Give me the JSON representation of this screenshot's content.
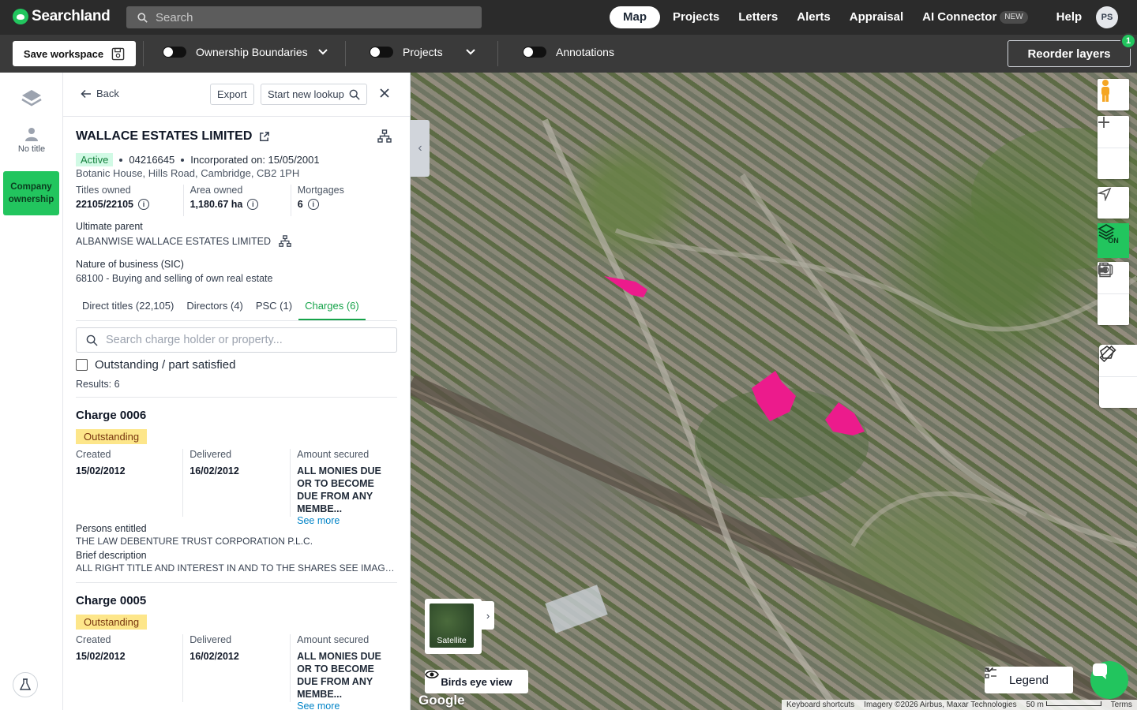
{
  "nav": {
    "logo": "Searchland",
    "search_placeholder": "Search",
    "items": [
      {
        "label": "Map",
        "active": true
      },
      {
        "label": "Projects"
      },
      {
        "label": "Letters"
      },
      {
        "label": "Alerts"
      },
      {
        "label": "Appraisal"
      },
      {
        "label": "AI Connector",
        "badge": "NEW"
      },
      {
        "label": "Help"
      }
    ],
    "avatar_initials": "PS"
  },
  "toolbar": {
    "save_workspace": "Save workspace",
    "ownership_boundaries": "Ownership Boundaries",
    "projects": "Projects",
    "annotations": "Annotations",
    "reorder_layers": "Reorder layers",
    "reorder_badge": "1"
  },
  "rail": {
    "no_title": "No title",
    "company_ownership": "Company ownership"
  },
  "panel": {
    "back": "Back",
    "export": "Export",
    "start_new_lookup": "Start new lookup",
    "company_name": "WALLACE ESTATES LIMITED",
    "status": "Active",
    "company_number": "04216645",
    "incorporated": "Incorporated on: 15/05/2001",
    "address": "Botanic House, Hills Road, Cambridge, CB2 1PH",
    "stats": {
      "titles_label": "Titles owned",
      "titles_value": "22105/22105",
      "area_label": "Area owned",
      "area_value": "1,180.67 ha",
      "mortgages_label": "Mortgages",
      "mortgages_value": "6"
    },
    "ultimate_parent_label": "Ultimate parent",
    "ultimate_parent_value": "ALBANWISE WALLACE ESTATES LIMITED",
    "nature_label": "Nature of business (SIC)",
    "nature_value": "68100 - Buying and selling of own real estate",
    "tabs": [
      {
        "label": "Direct titles (22,105)"
      },
      {
        "label": "Directors (4)"
      },
      {
        "label": "PSC (1)"
      },
      {
        "label": "Charges (6)",
        "active": true
      }
    ],
    "charge_search_placeholder": "Search charge holder or property...",
    "outstanding_filter": "Outstanding / part satisfied",
    "results": "Results: 6",
    "charges": [
      {
        "title": "Charge 0006",
        "status": "Outstanding",
        "created_label": "Created",
        "created": "15/02/2012",
        "delivered_label": "Delivered",
        "delivered": "16/02/2012",
        "amount_label": "Amount secured",
        "amount": "ALL MONIES DUE OR TO BECOME DUE FROM ANY MEMBE...",
        "see_more": "See more",
        "persons_label": "Persons entitled",
        "persons": "THE LAW DEBENTURE TRUST CORPORATION P.L.C.",
        "brief_label": "Brief description",
        "brief": "ALL RIGHT TITLE AND INTEREST IN AND TO THE SHARES SEE IMAGE FOR FULL DETAILS"
      },
      {
        "title": "Charge 0005",
        "status": "Outstanding",
        "created_label": "Created",
        "created": "15/02/2012",
        "delivered_label": "Delivered",
        "delivered": "16/02/2012",
        "amount_label": "Amount secured",
        "amount": "ALL MONIES DUE OR TO BECOME DUE FROM ANY MEMBE...",
        "see_more": "See more"
      }
    ]
  },
  "map": {
    "layers_on": "ON",
    "satellite": "Satellite",
    "birds_eye": "Birds eye view",
    "legend": "Legend",
    "google": "Google",
    "keyboard_shortcuts": "Keyboard shortcuts",
    "imagery": "Imagery ©2026 Airbus, Maxar Technologies",
    "scale": "50 m",
    "terms": "Terms",
    "parcel_color": "#ec1b8c"
  }
}
